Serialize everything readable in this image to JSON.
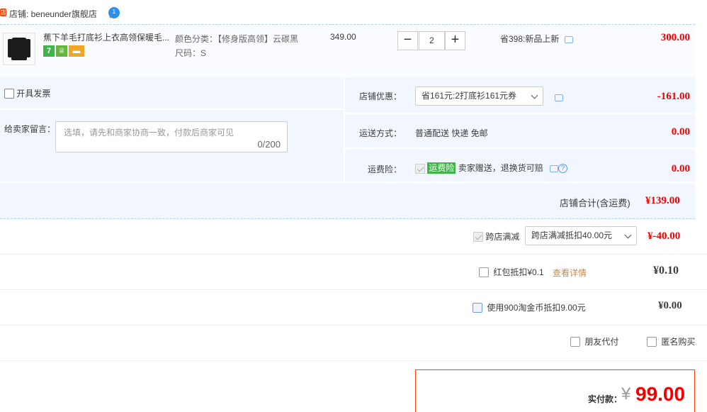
{
  "shop": {
    "label": "店铺: beneunder旗舰店"
  },
  "item": {
    "title": "蕉下羊毛打底衫上衣高领保暖毛...",
    "sku_color": "颜色分类：【修身版高领】云碳黑",
    "sku_size": "尺码：S",
    "unit_price": "349.00",
    "quantity": "2",
    "promo": "省398:新品上新",
    "total": "300.00",
    "badge_7": "7"
  },
  "invoice": {
    "label": "开具发票"
  },
  "memo": {
    "label": "给卖家留言：",
    "placeholder": "选填，请先和商家协商一致，付款后商家可见",
    "count": "0/200"
  },
  "shop_discount": {
    "label": "店铺优惠：",
    "selected": "省161元:2打底衫161元券",
    "amount": "-161.00"
  },
  "delivery": {
    "label": "运送方式：",
    "value": "普通配送 快递 免邮",
    "amount": "0.00"
  },
  "insurance": {
    "label": "运费险：",
    "tag": "运费险",
    "desc": "卖家赠送，退换货可赔",
    "amount": "0.00"
  },
  "shop_total": {
    "label": "店铺合计(含运费)",
    "amount": "¥139.00"
  },
  "cross_store": {
    "label": "跨店满减",
    "selected": "跨店满减抵扣40.00元",
    "amount": "¥-40.00"
  },
  "red_packet": {
    "label": "红包抵扣¥0.1",
    "link": "查看详情",
    "amount": "¥0.10"
  },
  "taobao_coin": {
    "label": "使用900淘金币抵扣9.00元",
    "amount": "¥0.00"
  },
  "friend_pay": {
    "label": "朋友代付"
  },
  "anonymous": {
    "label": "匿名购买"
  },
  "payment": {
    "label": "实付款：",
    "currency": "¥",
    "amount": "99.00"
  }
}
